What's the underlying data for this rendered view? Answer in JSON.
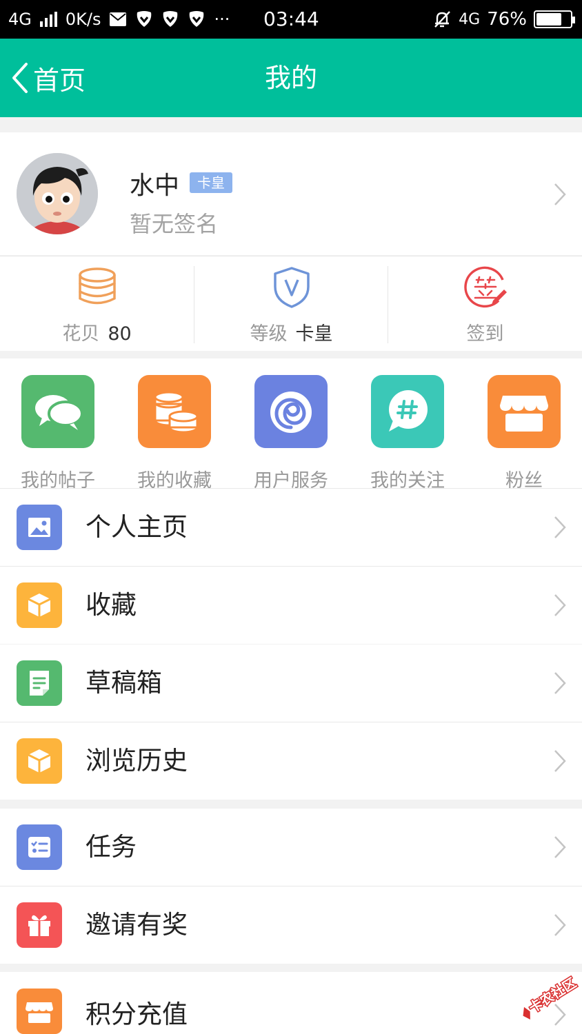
{
  "status_bar": {
    "network": "4G",
    "speed": "0K/s",
    "more": "···",
    "time": "03:44",
    "network_right": "4G",
    "battery": "76%",
    "battery_level": 0.76
  },
  "nav": {
    "back_label": "首页",
    "title": "我的"
  },
  "profile": {
    "name": "水中",
    "badge": "卡皇",
    "signature": "暂无签名"
  },
  "stats": [
    {
      "label": "花贝",
      "value": "80"
    },
    {
      "label": "等级",
      "value": "卡皇"
    },
    {
      "label": "签到",
      "value": ""
    }
  ],
  "quick_actions": [
    {
      "label": "我的帖子",
      "icon": "chat-bubbles-icon",
      "color": "#55b96f"
    },
    {
      "label": "我的收藏",
      "icon": "coin-stack-icon",
      "color": "#f98c3a"
    },
    {
      "label": "用户服务",
      "icon": "swirl-icon",
      "color": "#6b82e0"
    },
    {
      "label": "我的关注",
      "icon": "hashtag-icon",
      "color": "#3bc8b7"
    },
    {
      "label": "粉丝",
      "icon": "store-icon",
      "color": "#f98c3a"
    }
  ],
  "menu": [
    {
      "label": "个人主页",
      "icon": "image-icon",
      "color": "#6b88e0"
    },
    {
      "label": "收藏",
      "icon": "cube-icon",
      "color": "#fdb43c"
    },
    {
      "label": "草稿箱",
      "icon": "draft-note-icon",
      "color": "#55b96f"
    },
    {
      "label": "浏览历史",
      "icon": "cube-icon",
      "color": "#fdb43c"
    },
    {
      "label": "任务",
      "icon": "task-list-icon",
      "color": "#6b88e0"
    },
    {
      "label": "邀请有奖",
      "icon": "gift-icon",
      "color": "#f45456"
    },
    {
      "label": "积分充值",
      "icon": "store-icon",
      "color": "#f98c3a"
    }
  ],
  "watermark_text": "卡农社区",
  "colors": {
    "primary": "#00bf9b",
    "badge": "#8db3ee",
    "signin_red": "#e8464a",
    "bei_orange": "#f0a05a",
    "level_blue": "#6e94d8"
  }
}
